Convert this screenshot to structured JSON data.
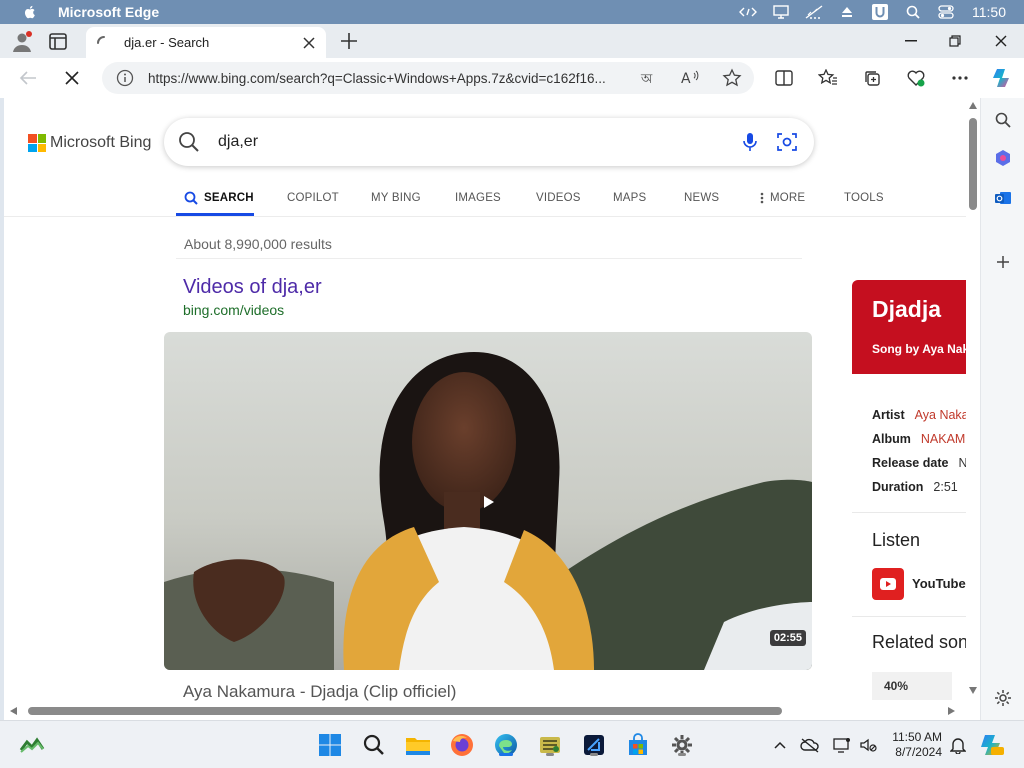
{
  "menubar": {
    "app_name": "Microsoft Edge",
    "clock": "11:50"
  },
  "tab": {
    "title": "dja.er - Search"
  },
  "address": {
    "url": "https://www.bing.com/search?q=Classic+Windows+Apps.7z&cvid=c162f16..."
  },
  "bing": {
    "logo_text": "Microsoft Bing",
    "query": "dja,er",
    "scopes": [
      {
        "label": "SEARCH",
        "active": true
      },
      {
        "label": "COPILOT"
      },
      {
        "label": "MY BING"
      },
      {
        "label": "IMAGES"
      },
      {
        "label": "VIDEOS"
      },
      {
        "label": "MAPS"
      },
      {
        "label": "NEWS"
      },
      {
        "label": "MORE"
      },
      {
        "label": "TOOLS"
      }
    ],
    "result_count": "About 8,990,000 results",
    "videos_heading": "Videos of dja,er",
    "videos_url": "bing.com/videos",
    "video_duration": "02:55",
    "video_title": "Aya Nakamura - Djadja (Clip officiel)"
  },
  "knowledge_panel": {
    "title": "Djadja",
    "subtitle": "Song by Aya Nakamura",
    "facts": [
      {
        "label": "Artist",
        "value": "Aya Nakamura"
      },
      {
        "label": "Album",
        "value": "NAKAMURA"
      },
      {
        "label": "Release date",
        "value": "N"
      },
      {
        "label": "Duration",
        "value": "2:51"
      }
    ],
    "listen_heading": "Listen",
    "youtube_label": "YouTube",
    "related_heading": "Related songs",
    "related_percent": "40%"
  },
  "taskbar": {
    "time": "11:50 AM",
    "date": "8/7/2024"
  },
  "colors": {
    "bing_blue": "#174ae4",
    "panel_red": "#c50f1f",
    "link_purple": "#4e2ba8",
    "url_green": "#1e6e2a"
  }
}
